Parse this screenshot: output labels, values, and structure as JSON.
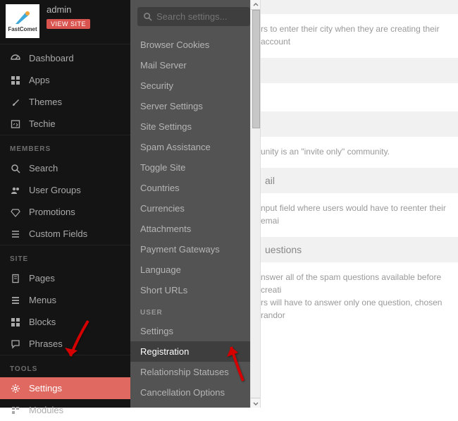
{
  "brand": {
    "name": "FastComet",
    "username": "admin",
    "view_site": "VIEW SITE"
  },
  "nav": {
    "primary": [
      {
        "label": "Dashboard"
      },
      {
        "label": "Apps"
      },
      {
        "label": "Themes"
      },
      {
        "label": "Techie"
      }
    ],
    "members_label": "MEMBERS",
    "members": [
      {
        "label": "Search"
      },
      {
        "label": "User Groups"
      },
      {
        "label": "Promotions"
      },
      {
        "label": "Custom Fields"
      }
    ],
    "site_label": "SITE",
    "site": [
      {
        "label": "Pages"
      },
      {
        "label": "Menus"
      },
      {
        "label": "Blocks"
      },
      {
        "label": "Phrases"
      }
    ],
    "tools_label": "TOOLS",
    "tools": [
      {
        "label": "Settings"
      },
      {
        "label": "Modules"
      }
    ]
  },
  "subpanel": {
    "search_placeholder": "Search settings...",
    "general": [
      "Browser Cookies",
      "Mail Server",
      "Security",
      "Server Settings",
      "Site Settings",
      "Spam Assistance",
      "Toggle Site",
      "Countries",
      "Currencies",
      "Attachments",
      "Payment Gateways",
      "Language",
      "Short URLs"
    ],
    "user_label": "USER",
    "user": [
      "Settings",
      "Registration",
      "Relationship Statuses",
      "Cancellation Options"
    ]
  },
  "content": {
    "rows": [
      {
        "head": "",
        "body": "rs to enter their city when they are creating their account"
      },
      {
        "head": "",
        "body": ""
      },
      {
        "head": "",
        "body": "unity is an \"invite only\" community."
      },
      {
        "head": "ail",
        "body": ""
      },
      {
        "head": "",
        "body": "nput field where users would have to reenter their emai"
      },
      {
        "head": "uestions",
        "body": ""
      },
      {
        "head": "",
        "body": "nswer all of the spam questions available before creati\nrs will have to answer only one question, chosen randor"
      }
    ]
  }
}
